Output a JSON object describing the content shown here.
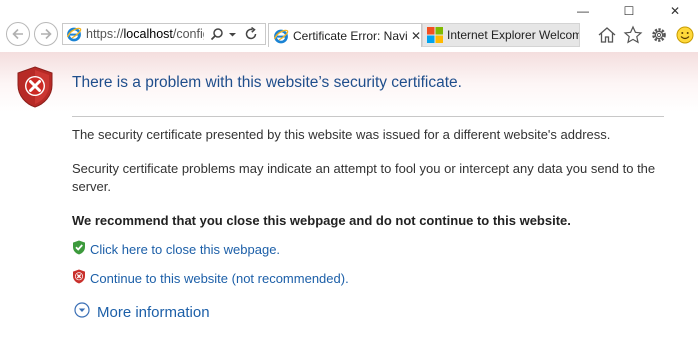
{
  "window": {
    "controls": {
      "minimize": "—",
      "maximize": "☐",
      "close": "✕"
    }
  },
  "toolbar": {
    "address": {
      "scheme": "https://",
      "host": "localhost",
      "path": "/configur"
    },
    "tabs": [
      {
        "label": "Certificate Error: Navig...",
        "close": "✕",
        "active": true
      },
      {
        "label": "Internet Explorer Welcome",
        "active": false
      }
    ],
    "icons": [
      "home-icon",
      "favorites-star-icon",
      "settings-gear-icon",
      "feedback-smiley-icon"
    ]
  },
  "page": {
    "title": "There is a problem with this website’s security certificate.",
    "paragraph1": "The security certificate presented by this website was issued for a different website's address.",
    "paragraph2": "Security certificate problems may indicate an attempt to fool you or intercept any data you send to the server.",
    "recommendation": "We recommend that you close this webpage and do not continue to this website.",
    "close_link": "Click here to close this webpage.",
    "continue_link": "Continue to this website (not recommended).",
    "more_info": "More information"
  },
  "colors": {
    "title": "#1f4e8c",
    "link": "#1c5fa8",
    "shield_red": "#c9302c",
    "check_green": "#3c9a3c",
    "banner_tint": "#f4dede"
  }
}
